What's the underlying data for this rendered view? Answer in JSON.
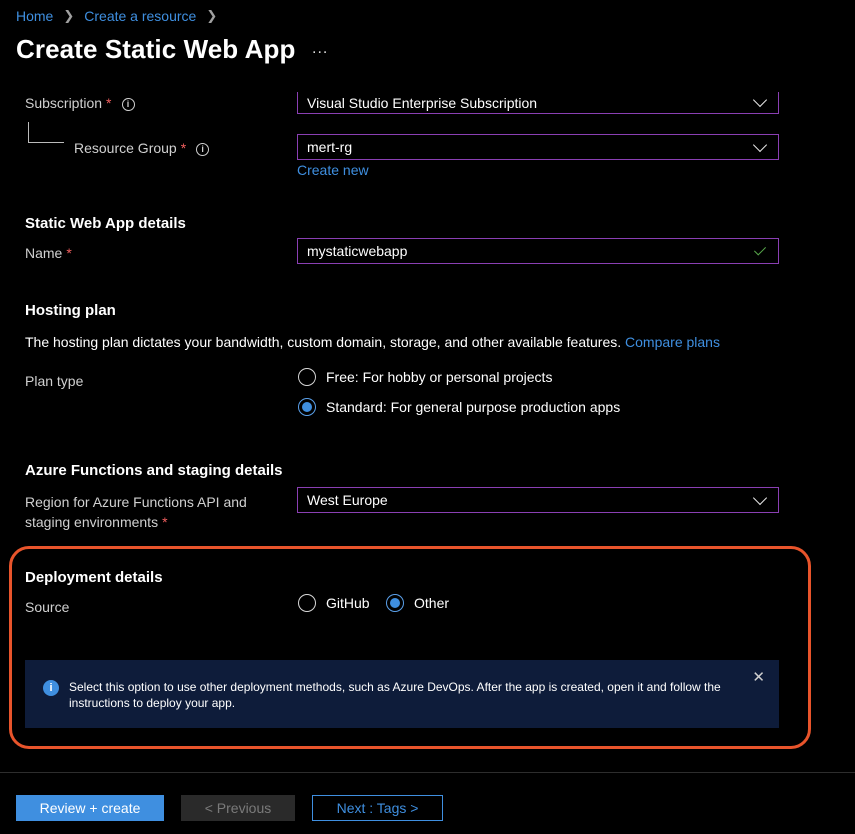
{
  "breadcrumb": {
    "items": [
      "Home",
      "Create a resource"
    ]
  },
  "page": {
    "title": "Create Static Web App",
    "more": "..."
  },
  "subscription": {
    "label": "Subscription",
    "required": "*",
    "value": "Visual Studio Enterprise Subscription"
  },
  "resource_group": {
    "label": "Resource Group",
    "required": "*",
    "value": "mert-rg",
    "create_new": "Create new"
  },
  "details": {
    "heading": "Static Web App details",
    "name_label": "Name",
    "required": "*",
    "name_value": "mystaticwebapp"
  },
  "hosting": {
    "heading": "Hosting plan",
    "description": "The hosting plan dictates your bandwidth, custom domain, storage, and other available features.",
    "compare_link": "Compare plans",
    "plan_type_label": "Plan type",
    "options": [
      "Free: For hobby or personal projects",
      "Standard: For general purpose production apps"
    ],
    "selected": "Standard: For general purpose production apps"
  },
  "functions": {
    "heading": "Azure Functions and staging details",
    "region_label_line1": "Region for Azure Functions API and",
    "region_label_line2": "staging environments",
    "required": "*",
    "region_value": "West Europe"
  },
  "deployment": {
    "heading": "Deployment details",
    "source_label": "Source",
    "options": [
      "GitHub",
      "Other"
    ],
    "selected": "Other",
    "info_text": "Select this option to use other deployment methods, such as Azure DevOps. After the app is created, open it and follow the instructions to deploy your app.",
    "info_icon": "info-icon",
    "close_icon": "close-icon"
  },
  "footer": {
    "review": "Review + create",
    "previous": "< Previous",
    "next": "Next : Tags >"
  },
  "colors": {
    "accent": "#3f8fe0",
    "highlight": "#e8542b",
    "field_border": "#8a3fb3",
    "required": "#f25f5f"
  }
}
